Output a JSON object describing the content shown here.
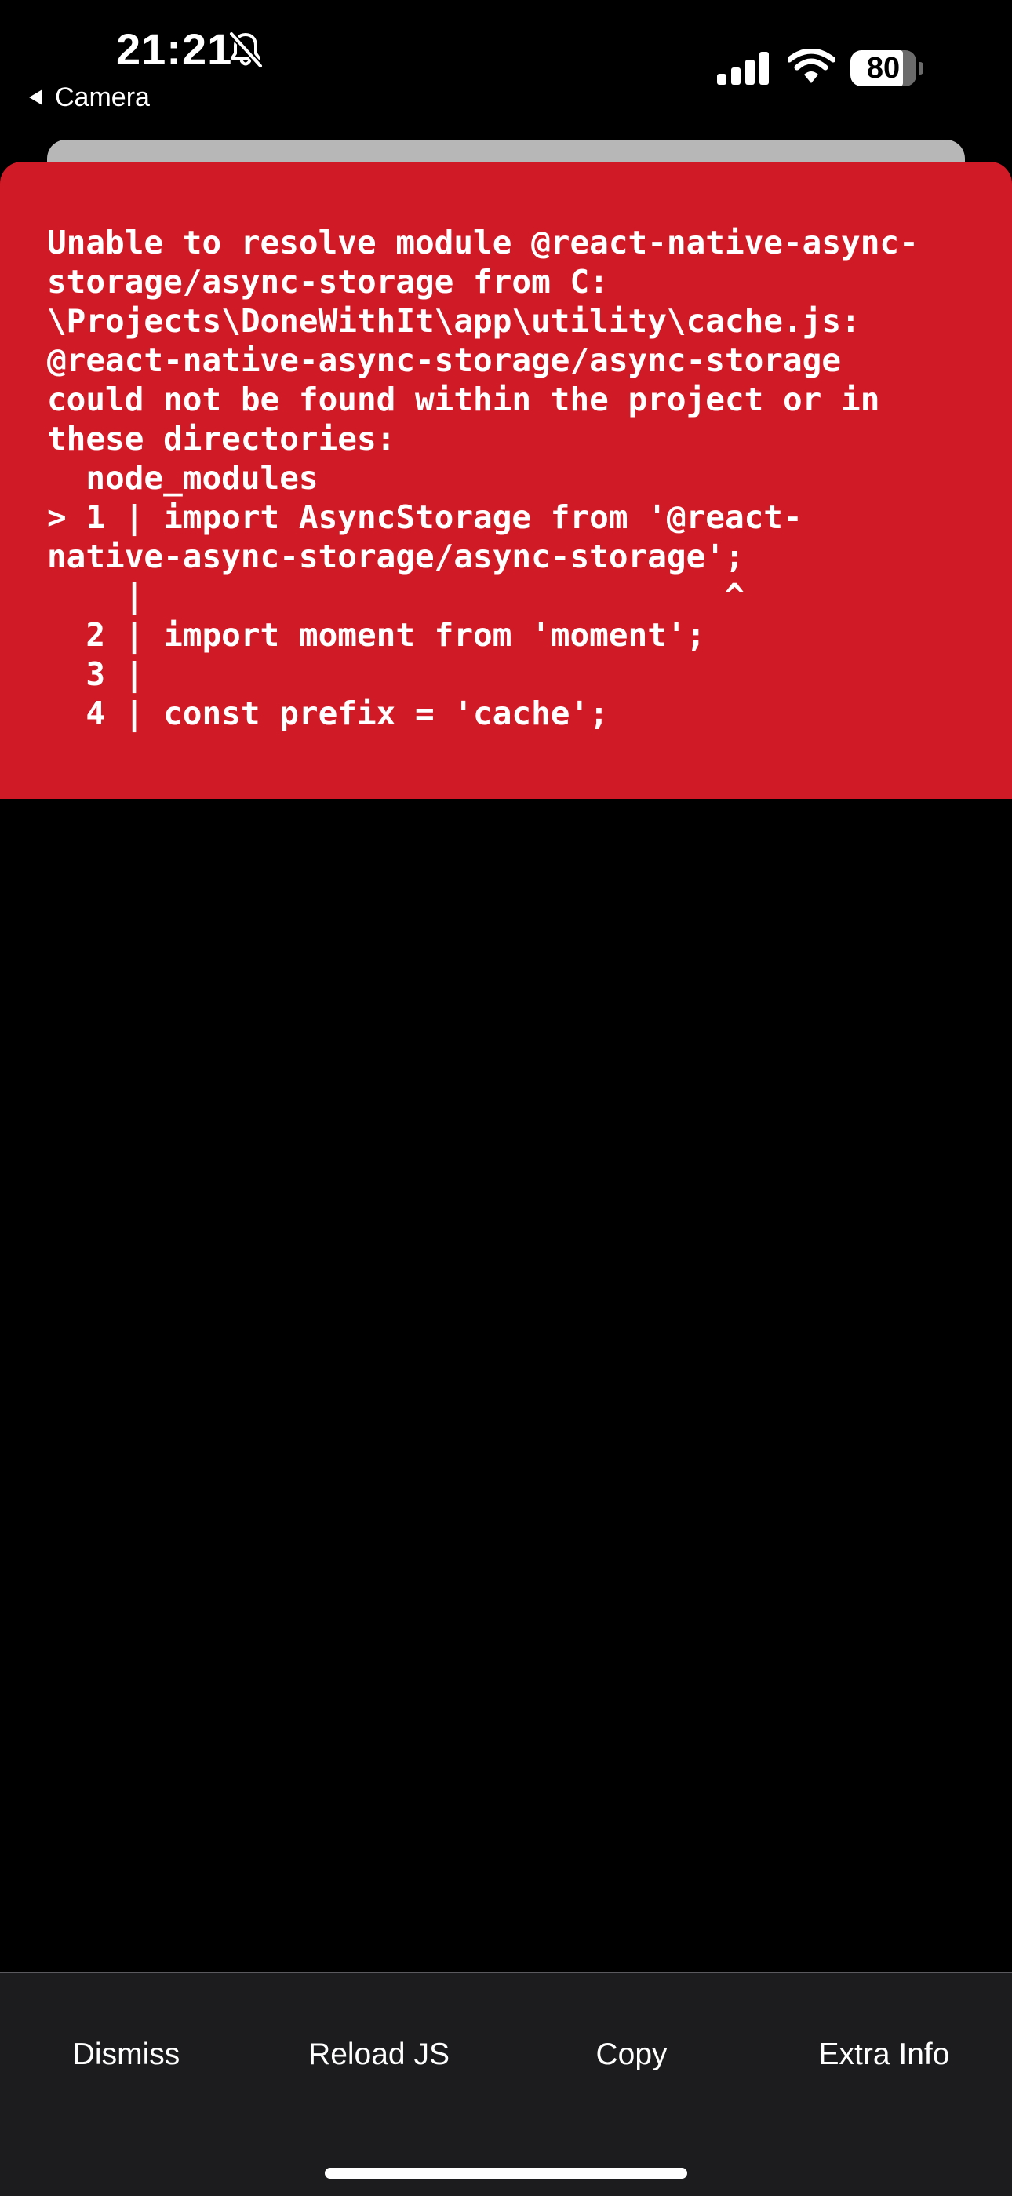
{
  "status_bar": {
    "time": "21:21",
    "back_label": "Camera",
    "battery_percent": "80",
    "battery_level": 0.8,
    "icons": [
      "bell-slash-icon",
      "back-arrow-icon",
      "cellular-signal-icon",
      "wifi-icon",
      "battery-icon"
    ]
  },
  "error": {
    "message": "Unable to resolve module @react-native-async-\nstorage/async-storage from C:\n\\Projects\\DoneWithIt\\app\\utility\\cache.js:\n@react-native-async-storage/async-storage\ncould not be found within the project or in\nthese directories:\n  node_modules\n> 1 | import AsyncStorage from '@react-\nnative-async-storage/async-storage';\n    |                              ^\n  2 | import moment from 'moment';\n  3 |\n  4 | const prefix = 'cache';"
  },
  "toolbar": {
    "dismiss_label": "Dismiss",
    "reload_label": "Reload JS",
    "copy_label": "Copy",
    "extra_info_label": "Extra Info"
  },
  "colors": {
    "error_background": "#d01a26",
    "toolbar_background": "#1c1c1e",
    "page_background": "#000000",
    "text": "#ffffff"
  }
}
